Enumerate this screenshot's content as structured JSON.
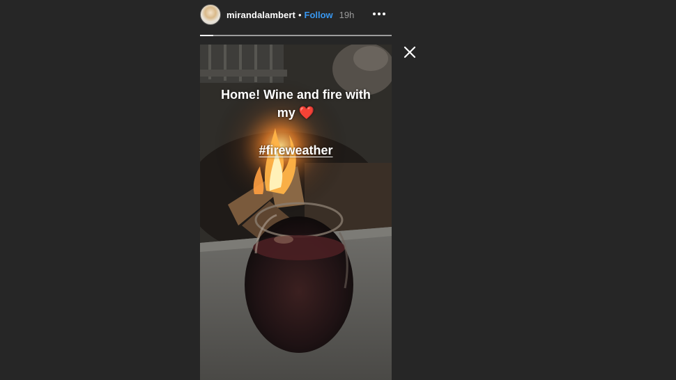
{
  "header": {
    "username": "mirandalambert",
    "separator": "•",
    "follow_label": "Follow",
    "timestamp": "19h",
    "more_icon": "more-options-icon"
  },
  "progress": {
    "fraction": 0.07
  },
  "story": {
    "caption_line1": "Home! Wine and fire with",
    "caption_line2": "my",
    "caption_emoji": "❤️",
    "hashtag": "#fireweather"
  },
  "controls": {
    "close_icon": "close-icon"
  },
  "colors": {
    "background": "#262626",
    "link": "#3897f0",
    "heart": "#ed2f3b"
  }
}
